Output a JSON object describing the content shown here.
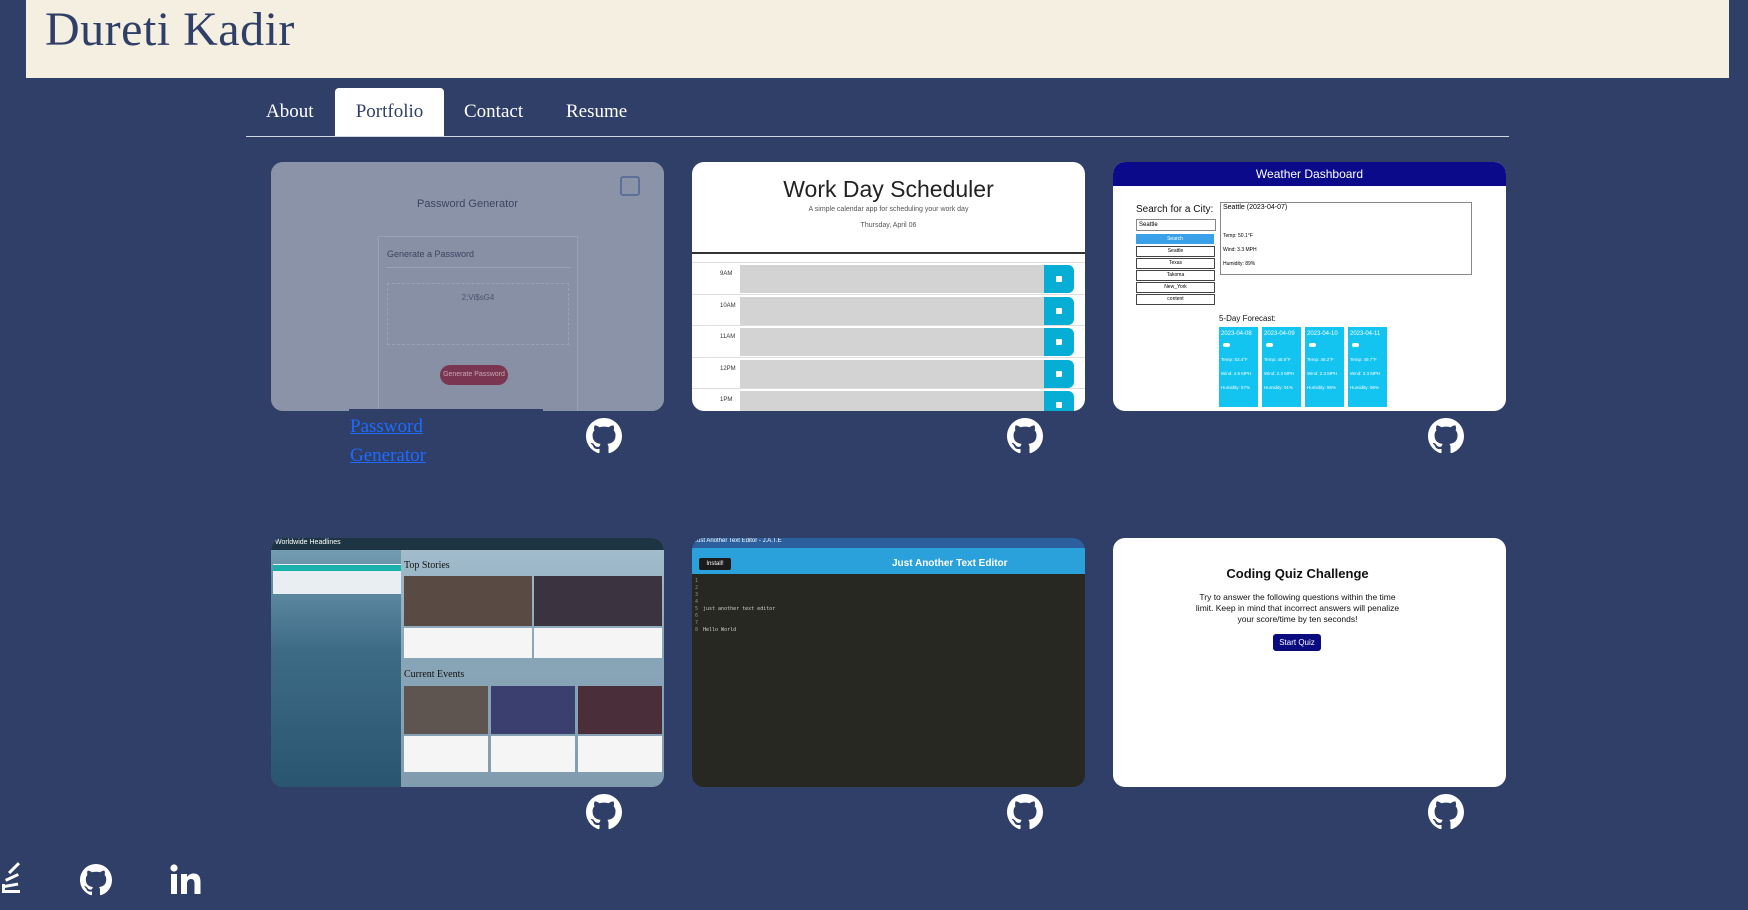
{
  "header": {
    "name": "Dureti Kadir"
  },
  "nav": {
    "tabs": [
      "About",
      "Portfolio",
      "Contact",
      "Resume"
    ],
    "active": "Portfolio"
  },
  "projects": {
    "password": {
      "title": "Password Generator",
      "link_label": "Password Generator",
      "shot": {
        "label": "Generate a Password",
        "field": "2;Vi$sG4",
        "button": "Generate Password"
      }
    },
    "scheduler": {
      "title": "Work Day Scheduler",
      "subtitle": "A simple calendar app for scheduling your work day",
      "date": "Thursday, April 06",
      "hours": [
        "9AM",
        "10AM",
        "11AM",
        "12PM",
        "1PM"
      ]
    },
    "weather": {
      "title": "Weather Dashboard",
      "search_label": "Search for a City:",
      "search_value": "Seattle",
      "search_button": "Search",
      "cities": [
        "Seattle",
        "Texas",
        "Takoma",
        "New_York",
        "content"
      ],
      "current": {
        "heading": "Seattle (2023-04-07)",
        "temp": "Temp: 50.1°F",
        "wind": "Wind: 3.3 MPH",
        "humidity": "Humidity: 89%"
      },
      "forecast_label": "5-Day Forecast:",
      "forecast": [
        {
          "date": "2023-04-08",
          "temp": "Temp: 53.4°F",
          "wind": "Wind: 4.6 MPH",
          "humidity": "Humidity: 57%"
        },
        {
          "date": "2023-04-09",
          "temp": "Temp: 48.6°F",
          "wind": "Wind: 2.3 MPH",
          "humidity": "Humidity: 91%"
        },
        {
          "date": "2023-04-10",
          "temp": "Temp: 48.2°F",
          "wind": "Wind: 2.3 MPH",
          "humidity": "Humidity: 95%"
        },
        {
          "date": "2023-04-11",
          "temp": "Temp: 49.7°F",
          "wind": "Wind: 3.3 MPH",
          "humidity": "Humidity: 96%"
        }
      ]
    },
    "news": {
      "brand": "Worldwide Headlines",
      "sections": [
        "Top Stories",
        "Current Events"
      ]
    },
    "editor": {
      "tab_title": "Just Another Text Editor - J.A.T.E",
      "install": "Install!",
      "title": "Just Another Text Editor",
      "lines": [
        "",
        "",
        "",
        "",
        "just another text editor",
        "",
        "",
        "Hello World"
      ]
    },
    "quiz": {
      "title": "Coding Quiz Challenge",
      "body": "Try to answer the following questions within the time limit. Keep in mind that incorrect answers will penalize your score/time by ten seconds!",
      "button": "Start Quiz"
    }
  },
  "footer": {
    "icons": [
      "stackoverflow-icon",
      "github-icon",
      "linkedin-icon"
    ]
  },
  "colors": {
    "background": "#2f3f68",
    "header_bg": "#f4efe1",
    "link": "#1f6bff"
  }
}
